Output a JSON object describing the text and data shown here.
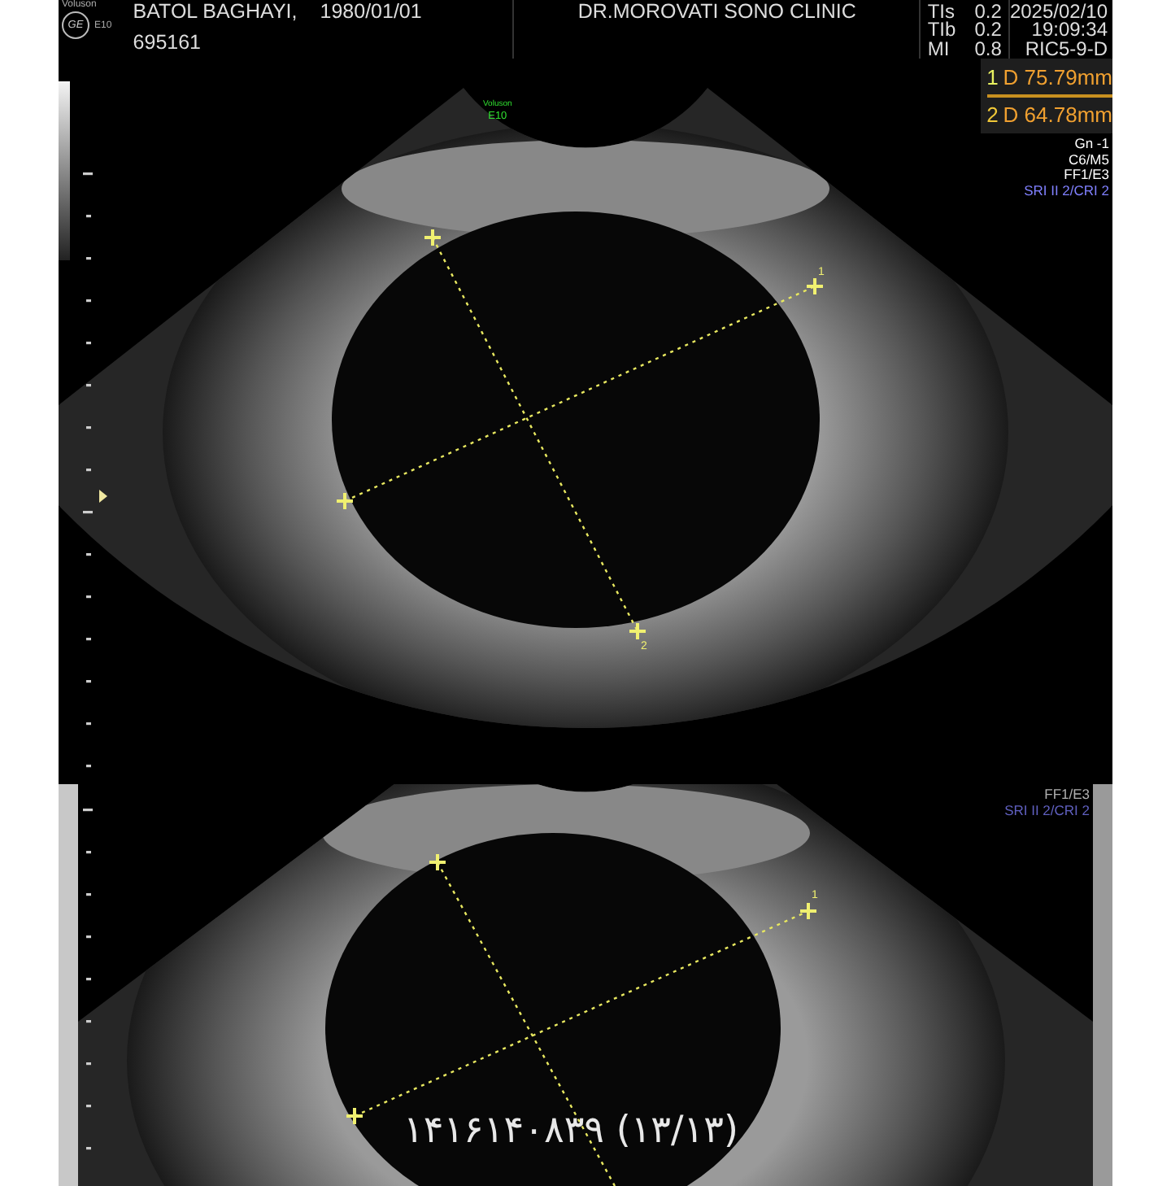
{
  "header": {
    "logo": {
      "brand": "Voluson",
      "mark": "GE",
      "model": "E10"
    },
    "patient": {
      "name": "BATOL BAGHAYI,",
      "birth_date": "1980/01/01",
      "id": "695161"
    },
    "clinic": "DR.MOROVATI SONO CLINIC",
    "indices": [
      {
        "label": "TIs",
        "value": "0.2"
      },
      {
        "label": "TIb",
        "value": "0.2"
      },
      {
        "label": "MI",
        "value": "0.8"
      }
    ],
    "date": "2025/02/10",
    "time": "19:09:34",
    "probe": "RIC5-9-D"
  },
  "measurements": [
    {
      "index": "1",
      "color": "#e8f060",
      "label": "D 75.79mm"
    },
    {
      "index": "2",
      "color": "#f0c838",
      "label": "D 64.78mm"
    }
  ],
  "top_image": {
    "device_label": [
      "Voluson",
      "E10"
    ],
    "settings": [
      {
        "text": "Gn  -1",
        "color": "#ffffff"
      },
      {
        "text": "C6/M5",
        "color": "#ffffff"
      },
      {
        "text": "FF1/E3",
        "color": "#ffffff"
      },
      {
        "text": "SRI II 2/CRI 2",
        "color": "#8080ff"
      }
    ],
    "caliper_labels": [
      "1",
      "2"
    ]
  },
  "bottom_image": {
    "settings": [
      {
        "text": "FF1/E3",
        "color": "#b0b0b0"
      },
      {
        "text": "SRI II 2/CRI 2",
        "color": "#6060c0"
      }
    ],
    "caliper_labels": [
      "1"
    ]
  },
  "caption": "۱۴۱۶۱۴۰۸۳۹ (۱۳/۱۳)"
}
